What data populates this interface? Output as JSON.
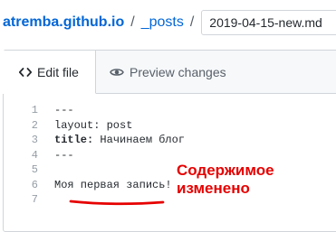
{
  "breadcrumb": {
    "repo": "atremba.github.io",
    "separator": "/",
    "folder": "_posts"
  },
  "filename": {
    "value": "2019-04-15-new.md"
  },
  "tabs": {
    "edit": "Edit file",
    "preview": "Preview changes"
  },
  "editor": {
    "lines": [
      {
        "n": "1",
        "key": "",
        "text": "---"
      },
      {
        "n": "2",
        "key": "",
        "text": "layout: post"
      },
      {
        "n": "3",
        "key": "title:",
        "text": " Начинаем блог"
      },
      {
        "n": "4",
        "key": "",
        "text": "---"
      },
      {
        "n": "5",
        "key": "",
        "text": ""
      },
      {
        "n": "6",
        "key": "",
        "text": "Моя первая запись!"
      },
      {
        "n": "7",
        "key": "",
        "text": ""
      }
    ]
  },
  "annotation": {
    "line1": "Содержимое",
    "line2": "изменено",
    "color": "#e60000"
  },
  "colors": {
    "link": "#0366d6",
    "tab_bar": "#f6f8fa",
    "border": "#d1d5da"
  },
  "icons": {
    "edit": "code-icon",
    "preview": "eye-icon"
  }
}
